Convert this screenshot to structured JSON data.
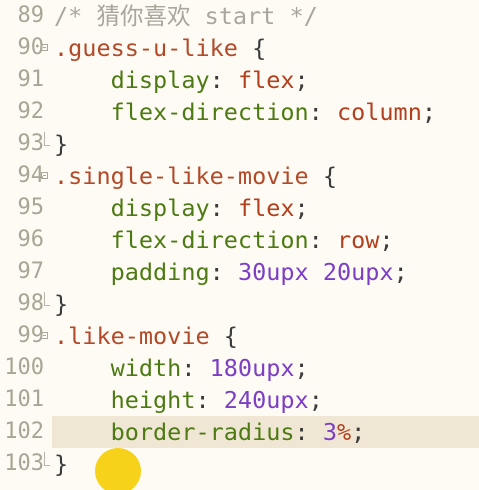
{
  "editor": {
    "language": "css",
    "highlighted_line": "102",
    "colors": {
      "background": "#fdfbf4",
      "line_highlight": "#efe6d3",
      "selector": "#b24a2a",
      "property": "#4e7a14",
      "keyword_value": "#b2401f",
      "number_value": "#7c3ec5",
      "comment": "#a9a69c",
      "line_number": "#a9a596",
      "cursor_indicator": "#f7d21a"
    },
    "lines": [
      {
        "num": "89",
        "comment": "/* 猜你喜欢 start */"
      },
      {
        "num": "90",
        "selector": ".guess-u-like",
        "open": " {"
      },
      {
        "num": "91",
        "indent": "    ",
        "prop": "display",
        "colon": ": ",
        "value": "flex",
        "semi": ";"
      },
      {
        "num": "92",
        "indent": "    ",
        "prop": "flex-direction",
        "colon": ": ",
        "value": "column",
        "semi": ";"
      },
      {
        "num": "93",
        "close": "}"
      },
      {
        "num": "94",
        "selector": ".single-like-movie",
        "open": " {"
      },
      {
        "num": "95",
        "indent": "    ",
        "prop": "display",
        "colon": ": ",
        "value": "flex",
        "semi": ";"
      },
      {
        "num": "96",
        "indent": "    ",
        "prop": "flex-direction",
        "colon": ": ",
        "value": "row",
        "semi": ";"
      },
      {
        "num": "97",
        "indent": "    ",
        "prop": "padding",
        "colon": ": ",
        "num1": "30",
        "unit1": "upx",
        "space": " ",
        "num2": "20",
        "unit2": "upx",
        "semi": ";"
      },
      {
        "num": "98",
        "close": "}"
      },
      {
        "num": "99",
        "selector": ".like-movie",
        "open": " {"
      },
      {
        "num": "100",
        "indent": "    ",
        "prop": "width",
        "colon": ": ",
        "num1": "180",
        "unit1": "upx",
        "semi": ";"
      },
      {
        "num": "101",
        "indent": "    ",
        "prop": "height",
        "colon": ": ",
        "num1": "240",
        "unit1": "upx",
        "semi": ";"
      },
      {
        "num": "102",
        "indent": "    ",
        "prop": "border-radius",
        "colon": ": ",
        "num1": "3",
        "unit1": "%",
        "semi": ";"
      },
      {
        "num": "103",
        "close": "}"
      }
    ]
  }
}
